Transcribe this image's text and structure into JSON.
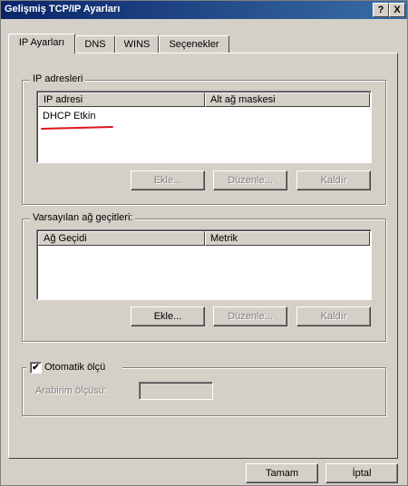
{
  "window": {
    "title": "Gelişmiş TCP/IP Ayarları",
    "help_button": "?",
    "close_button": "X"
  },
  "tabs": [
    {
      "label": "IP Ayarları",
      "active": true
    },
    {
      "label": "DNS",
      "active": false
    },
    {
      "label": "WINS",
      "active": false
    },
    {
      "label": "Seçenekler",
      "active": false
    }
  ],
  "ip_addresses": {
    "group_label": "IP adresleri",
    "columns": [
      "IP adresi",
      "Alt ağ maskesi"
    ],
    "rows": [
      {
        "text": "DHCP Etkin",
        "annotated": true
      }
    ],
    "buttons": {
      "add": {
        "label": "Ekle...",
        "enabled": false
      },
      "edit": {
        "label": "Düzenle...",
        "enabled": false
      },
      "remove": {
        "label": "Kaldır",
        "enabled": false
      }
    }
  },
  "gateways": {
    "group_label": "Varsayılan ağ geçitleri:",
    "columns": [
      "Ağ Geçidi",
      "Metrik"
    ],
    "rows": [],
    "buttons": {
      "add": {
        "label": "Ekle...",
        "enabled": true
      },
      "edit": {
        "label": "Düzenle...",
        "enabled": false
      },
      "remove": {
        "label": "Kaldır",
        "enabled": false
      }
    }
  },
  "metric": {
    "checkbox_label": "Otomatik ölçü",
    "checked": true,
    "check_glyph": "✔",
    "interface_metric_label": "Arabirim ölçüsü:",
    "interface_metric_value": ""
  },
  "footer": {
    "ok": "Tamam",
    "cancel": "İptal"
  },
  "colors": {
    "title_gradient_start": "#0a246a",
    "title_gradient_end": "#3a6ea5",
    "face": "#d4d0c8",
    "annotation_red": "#e0141e"
  }
}
